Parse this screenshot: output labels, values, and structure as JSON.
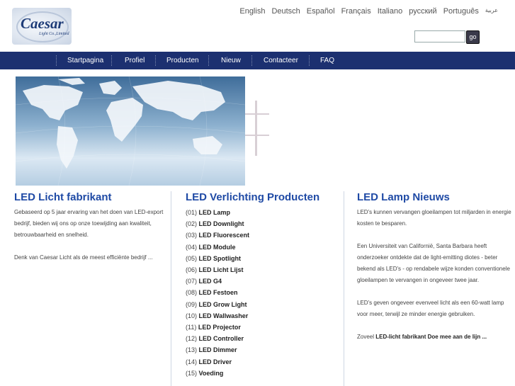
{
  "logo": {
    "name": "Caesar",
    "sub": "Light Co.,Limited"
  },
  "languages": [
    "English",
    "Deutsch",
    "Español",
    "Français",
    "Italiano",
    "русский",
    "Português",
    "عربية"
  ],
  "search": {
    "value": "",
    "button": "go"
  },
  "nav": [
    "Startpagina",
    "Profiel",
    "Producten",
    "Nieuw",
    "Contacteer",
    "FAQ"
  ],
  "col1": {
    "title": "LED Licht fabrikant",
    "p1": "Gebaseerd op 5 jaar ervaring van het doen van LED-export bedrijf, bieden wij ons op onze toewijding aan kwaliteit, betrouwbaarheid en snelheid.",
    "p2": "Denk van Caesar Licht als de meest efficiënte bedrijf ..."
  },
  "col2": {
    "title": "LED Verlichting Producten",
    "items": [
      {
        "num": "(01)",
        "label": "LED Lamp"
      },
      {
        "num": "(02)",
        "label": "LED Downlight"
      },
      {
        "num": "(03)",
        "label": "LED Fluorescent"
      },
      {
        "num": "(04)",
        "label": "LED Module"
      },
      {
        "num": "(05)",
        "label": "LED Spotlight"
      },
      {
        "num": "(06)",
        "label": "LED Licht Lijst"
      },
      {
        "num": "(07)",
        "label": "LED G4"
      },
      {
        "num": "(08)",
        "label": "LED Festoen"
      },
      {
        "num": "(09)",
        "label": "LED Grow Light"
      },
      {
        "num": "(10)",
        "label": "LED Wallwasher"
      },
      {
        "num": "(11)",
        "label": "LED Projector"
      },
      {
        "num": "(12)",
        "label": "LED Controller"
      },
      {
        "num": "(13)",
        "label": "LED Dimmer"
      },
      {
        "num": "(14)",
        "label": "LED Driver"
      },
      {
        "num": "(15)",
        "label": "Voeding"
      }
    ]
  },
  "col3": {
    "title": "LED Lamp Nieuws",
    "p1": "LED's kunnen vervangen gloeilampen tot miljarden in energie kosten te besparen.",
    "p2": "Een Universiteit van Californië, Santa Barbara heeft onderzoeker ontdekte dat de light-emitting diotes - beter bekend als LED's - op rendabele wijze konden conventionele gloeilampen te vervangen in ongeveer twee jaar.",
    "p3": "LED's geven ongeveer evenveel licht als een 60-watt lamp voor meer, terwijl ze minder energie gebruiken.",
    "p4_prefix": "Zoveel ",
    "p4_link": "LED-licht fabrikant Doe mee aan de lijn ..."
  }
}
